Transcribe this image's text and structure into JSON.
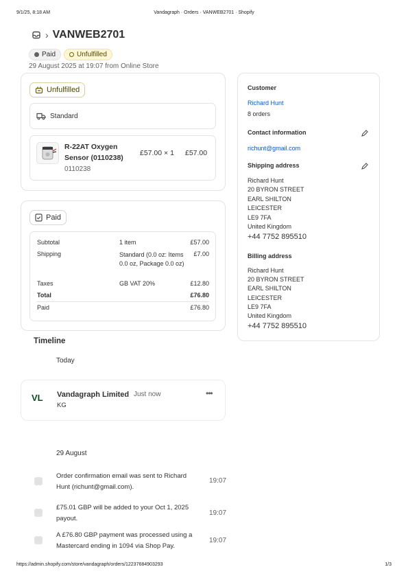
{
  "print_header": {
    "datetime": "9/1/25, 8:18 AM",
    "title": "Vandagraph · Orders · VANWEB2701 · Shopify"
  },
  "print_footer": {
    "url": "https://admin.shopify.com/store/vandagraph/orders/12237684903293",
    "page": "1/3"
  },
  "order": {
    "name": "VANWEB2701",
    "payment_badge": "Paid",
    "fulfillment_badge": "Unfulfilled",
    "subline": "29 August 2025 at 19:07 from Online Store"
  },
  "fulfillment_card": {
    "status_label": "Unfulfilled",
    "shipping_method": "Standard",
    "item": {
      "name": "R-22AT Oxygen Sensor (0110238)",
      "sku": "0110238",
      "unit_price": "£57.00",
      "times": "×",
      "qty": "1",
      "total": "£57.00"
    }
  },
  "payment_card": {
    "status_label": "Paid",
    "rows": {
      "subtotal": {
        "label": "Subtotal",
        "detail": "1 item",
        "amount": "£57.00"
      },
      "shipping": {
        "label": "Shipping",
        "detail": "Standard (0.0 oz: Items 0.0 oz, Package 0.0 oz)",
        "amount": "£7.00"
      },
      "taxes": {
        "label": "Taxes",
        "detail": "GB VAT 20%",
        "amount": "£12.80"
      },
      "total": {
        "label": "Total",
        "amount": "£76.80"
      },
      "paid": {
        "label": "Paid",
        "amount": "£76.80"
      }
    }
  },
  "customer": {
    "heading": "Customer",
    "name": "Richard Hunt",
    "orders": "8 orders",
    "contact_heading": "Contact information",
    "email": "richunt@gmail.com",
    "shipping_heading": "Shipping address",
    "shipping_address": {
      "line1": "Richard Hunt",
      "line2": "20 BYRON STREET",
      "line3": "EARL SHILTON",
      "line4": "LEICESTER",
      "line5": "LE9 7FA",
      "line6": "United Kingdom",
      "phone": "+44 7752 895510"
    },
    "billing_heading": "Billing address",
    "billing_address": {
      "line1": "Richard Hunt",
      "line2": "20 BYRON STREET",
      "line3": "EARL SHILTON",
      "line4": "LEICESTER",
      "line5": "LE9 7FA",
      "line6": "United Kingdom",
      "phone": "+44 7752 895510"
    }
  },
  "timeline": {
    "title": "Timeline",
    "today_label": "Today",
    "comment": {
      "avatar": "VL",
      "author": "Vandagraph Limited",
      "time": "Just now",
      "more": "•••",
      "body": "KG"
    },
    "date_label": "29 August",
    "events": [
      {
        "text": "Order confirmation email was sent to Richard Hunt (richunt@gmail.com).",
        "time": "19:07"
      },
      {
        "text": "£75.01 GBP will be added to your Oct 1, 2025 payout.",
        "time": "19:07"
      },
      {
        "text": "A £76.80 GBP payment was processed using a Mastercard ending in 1094 via Shop Pay.",
        "time": "19:07"
      }
    ]
  },
  "icons": {
    "inbox": "inbox-icon",
    "chevron": "chevron-right-icon",
    "fulfillment": "fulfillment-package-icon",
    "truck": "truck-icon",
    "receipt": "receipt-check-icon",
    "pencil": "pencil-icon"
  },
  "colors": {
    "unfulfilled_bg": "#fff7d6",
    "unfulfilled_text": "#4f4700",
    "paid_bg": "#f1f1f1",
    "avatar_text": "#0b4a1f"
  }
}
